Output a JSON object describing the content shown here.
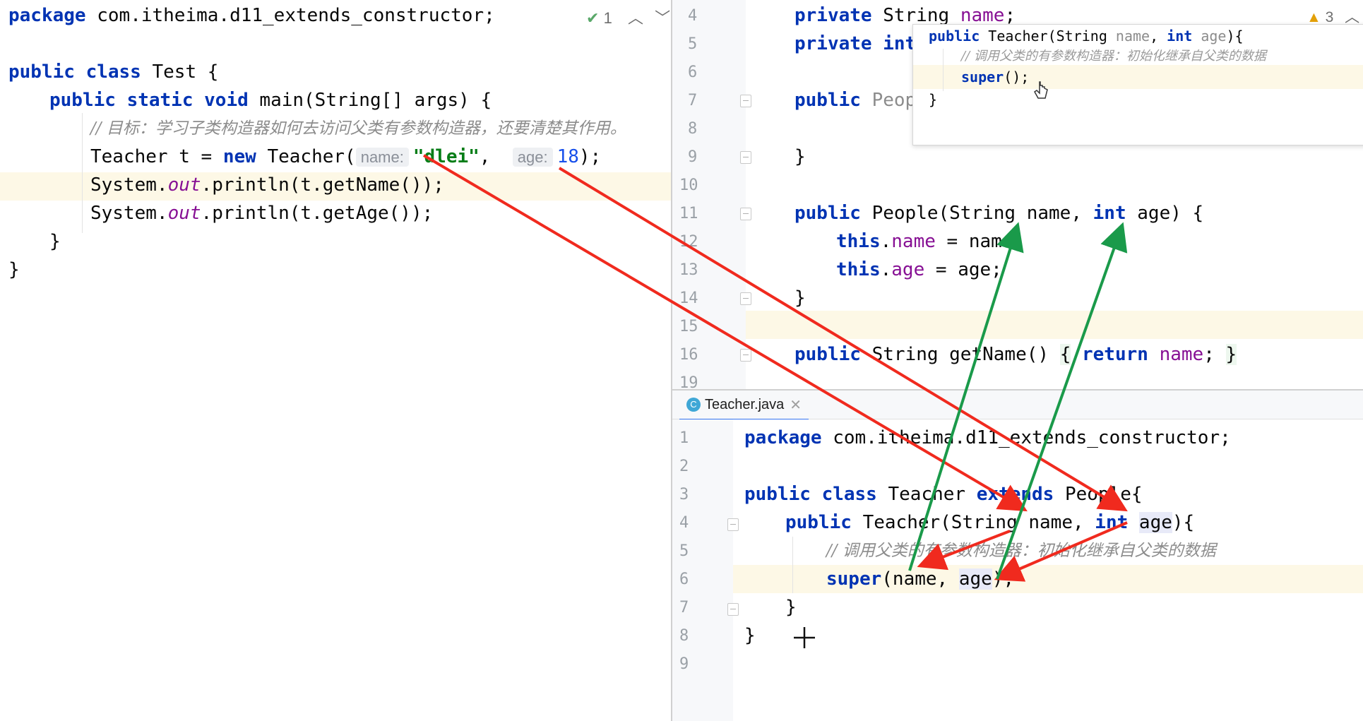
{
  "left": {
    "status": {
      "check_count": "1",
      "up": "^",
      "down": "v"
    },
    "lines": [
      "package com.itheima.d11_extends_constructor;",
      "",
      "public class Test {",
      "public static void main(String[] args) {",
      "// 目标：学习子类构造器如何去访问父类有参数构造器，还要清楚其作用。",
      "Teacher t = new Teacher(",
      "name:",
      "\"dlei\"",
      "age:",
      "18",
      "System.out.println(t.getName());",
      "System.out.println(t.getAge());",
      "}",
      "}"
    ]
  },
  "people": {
    "warning_count": "3",
    "line_numbers": [
      "4",
      "5",
      "6",
      "7",
      "8",
      "9",
      "10",
      "11",
      "12",
      "13",
      "14",
      "15",
      "16",
      "19"
    ],
    "code": {
      "l4": "private String name;",
      "l5": "private int",
      "l7": "public Peopl",
      "l9": "}",
      "l11": "public People(String name, int age) {",
      "l12": "this.name = name;",
      "l13": "this.age = age;",
      "l14": "}",
      "l16": "public String getName() { return name; }"
    },
    "popup": {
      "line1": "public Teacher(String name, int age){",
      "line2": "// 调用父类的有参数构造器：初始化继承自父类的数据",
      "line3": "super();",
      "line4": "}"
    }
  },
  "teacher": {
    "tab_label": "Teacher.java",
    "tab_icon_letter": "C",
    "line_numbers": [
      "1",
      "2",
      "3",
      "4",
      "5",
      "6",
      "7",
      "8",
      "9"
    ],
    "code": {
      "l1": "package com.itheima.d11_extends_constructor;",
      "l3": "public class Teacher extends People{",
      "l4": "public Teacher(String name, int age){",
      "l5": "// 调用父类的有参数构造器：初始化继承自父类的数据",
      "l6": "super(name, age);",
      "l7": "}",
      "l8": "}"
    }
  },
  "colors": {
    "red_arrow": "#f02a1e",
    "green_arrow": "#1a9a4a",
    "current_line": "#fdf8e6",
    "keyword": "#0033b3"
  }
}
